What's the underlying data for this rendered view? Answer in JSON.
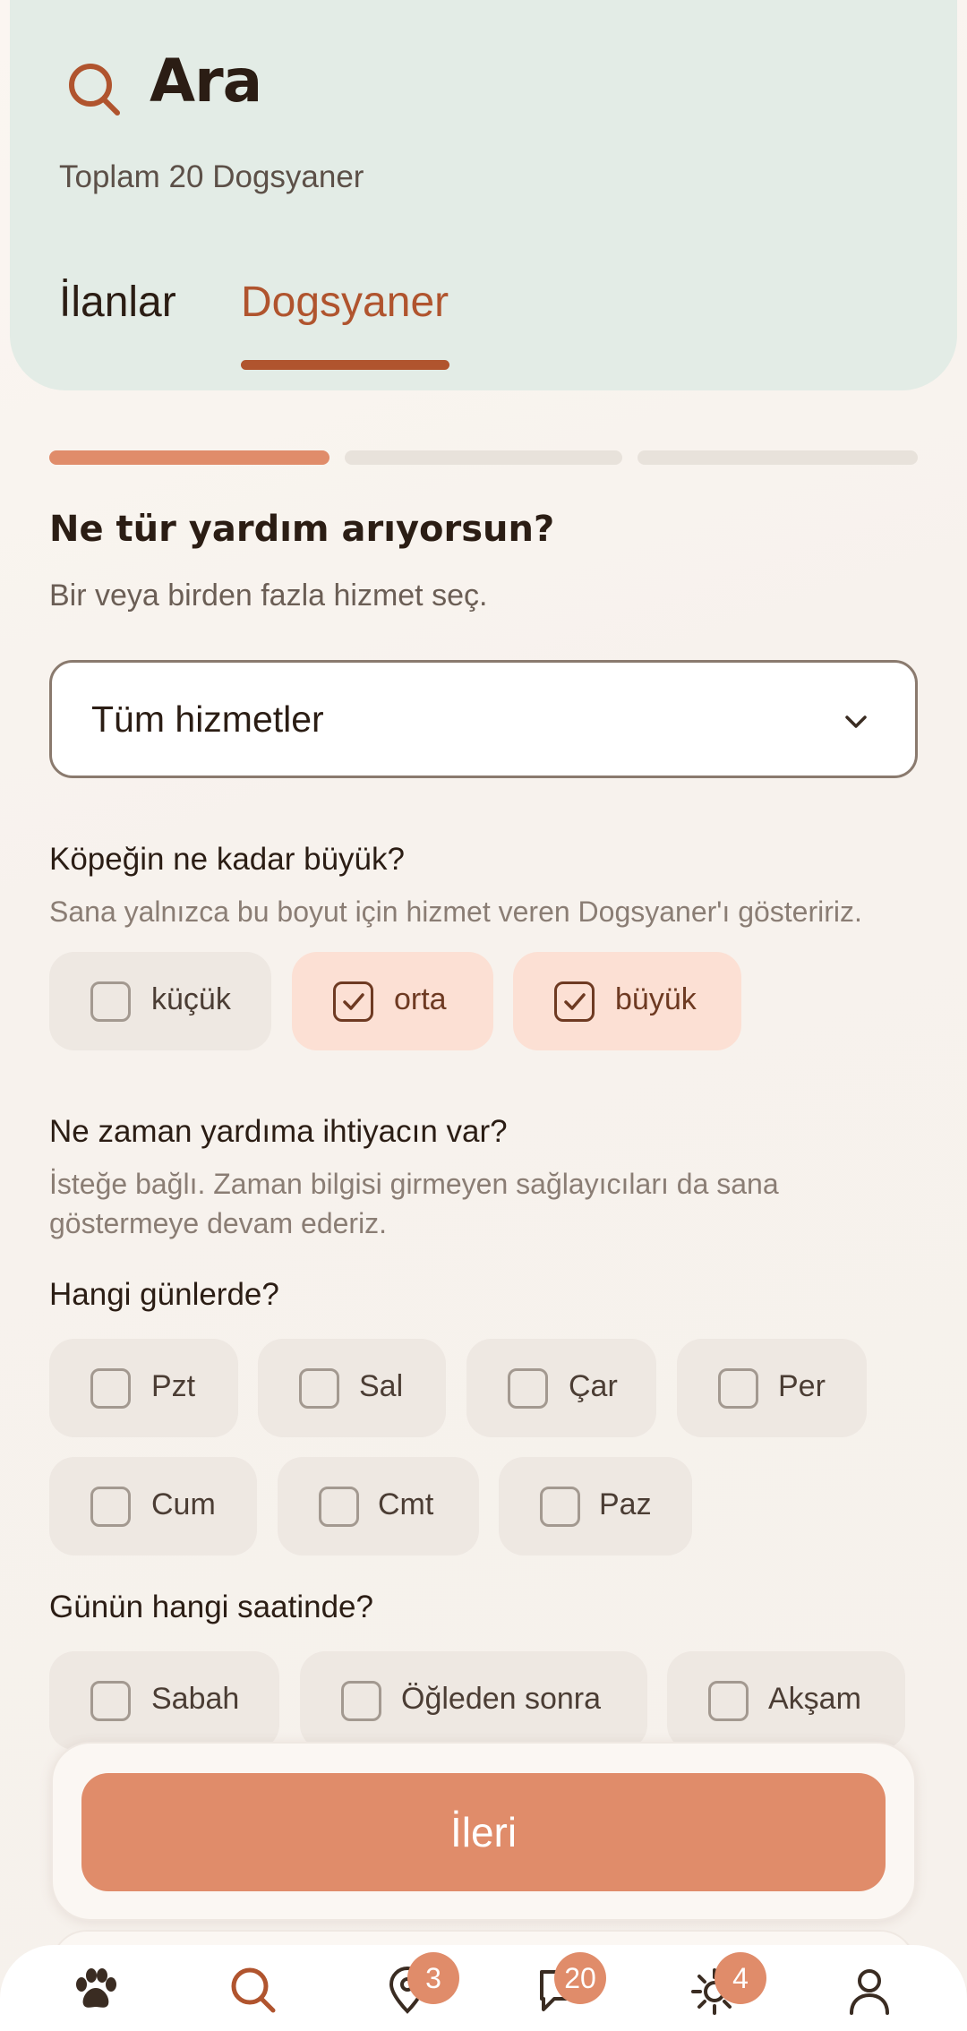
{
  "header": {
    "title": "Ara",
    "subtitle": "Toplam 20 Dogsyaner",
    "tabs": [
      {
        "label": "İlanlar",
        "active": false
      },
      {
        "label": "Dogsyaner",
        "active": true
      }
    ]
  },
  "progress": {
    "current_step": 1,
    "total_steps": 3
  },
  "service": {
    "question": "Ne tür yardım arıyorsun?",
    "hint": "Bir veya birden fazla hizmet seç.",
    "dropdown_value": "Tüm hizmetler"
  },
  "dog_size": {
    "question": "Köpeğin ne kadar büyük?",
    "hint": "Sana yalnızca bu boyut için hizmet veren Dogsyaner'ı gösteririz.",
    "options": [
      {
        "label": "küçük",
        "checked": false
      },
      {
        "label": "orta",
        "checked": true
      },
      {
        "label": "büyük",
        "checked": true
      }
    ]
  },
  "when": {
    "question": "Ne zaman yardıma ihtiyacın var?",
    "hint": "İsteğe bağlı. Zaman bilgisi girmeyen sağlayıcıları da sana göstermeye devam ederiz.",
    "days_question": "Hangi günlerde?",
    "days": [
      {
        "label": "Pzt",
        "checked": false
      },
      {
        "label": "Sal",
        "checked": false
      },
      {
        "label": "Çar",
        "checked": false
      },
      {
        "label": "Per",
        "checked": false
      },
      {
        "label": "Cum",
        "checked": false
      },
      {
        "label": "Cmt",
        "checked": false
      },
      {
        "label": "Paz",
        "checked": false
      }
    ],
    "time_question": "Günün hangi saatinde?",
    "times": [
      {
        "label": "Sabah",
        "checked": false
      },
      {
        "label": "Öğleden sonra",
        "checked": false
      },
      {
        "label": "Akşam",
        "checked": false
      }
    ]
  },
  "next_button": "İleri",
  "bottom_nav": {
    "items": [
      {
        "icon": "paw-icon",
        "active": false,
        "badge": ""
      },
      {
        "icon": "search-icon",
        "active": true,
        "badge": ""
      },
      {
        "icon": "location-pin-icon",
        "active": false,
        "badge": "3"
      },
      {
        "icon": "chat-icon",
        "active": false,
        "badge": "20"
      },
      {
        "icon": "sun-icon",
        "active": false,
        "badge": "4"
      },
      {
        "icon": "profile-icon",
        "active": false,
        "badge": ""
      }
    ]
  },
  "colors": {
    "accent": "#e08c6a",
    "brand_dark": "#b0542e",
    "header_bg": "#e3ece6",
    "chip_checked_bg": "#fce0d4"
  }
}
